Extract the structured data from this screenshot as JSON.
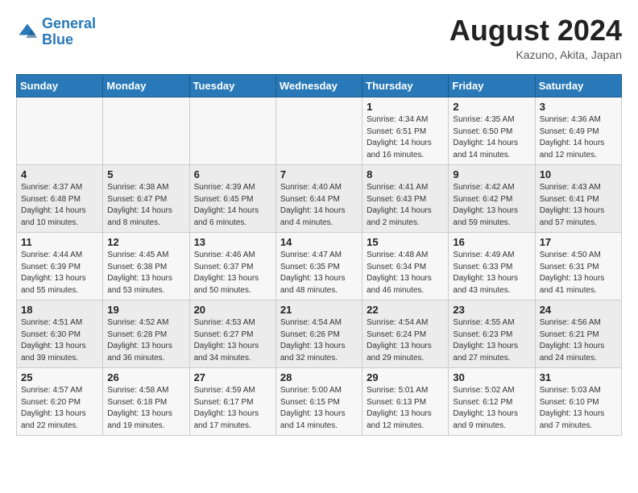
{
  "header": {
    "logo_line1": "General",
    "logo_line2": "Blue",
    "month_year": "August 2024",
    "location": "Kazuno, Akita, Japan"
  },
  "weekdays": [
    "Sunday",
    "Monday",
    "Tuesday",
    "Wednesday",
    "Thursday",
    "Friday",
    "Saturday"
  ],
  "weeks": [
    [
      {
        "day": "",
        "info": ""
      },
      {
        "day": "",
        "info": ""
      },
      {
        "day": "",
        "info": ""
      },
      {
        "day": "",
        "info": ""
      },
      {
        "day": "1",
        "info": "Sunrise: 4:34 AM\nSunset: 6:51 PM\nDaylight: 14 hours and 16 minutes."
      },
      {
        "day": "2",
        "info": "Sunrise: 4:35 AM\nSunset: 6:50 PM\nDaylight: 14 hours and 14 minutes."
      },
      {
        "day": "3",
        "info": "Sunrise: 4:36 AM\nSunset: 6:49 PM\nDaylight: 14 hours and 12 minutes."
      }
    ],
    [
      {
        "day": "4",
        "info": "Sunrise: 4:37 AM\nSunset: 6:48 PM\nDaylight: 14 hours and 10 minutes."
      },
      {
        "day": "5",
        "info": "Sunrise: 4:38 AM\nSunset: 6:47 PM\nDaylight: 14 hours and 8 minutes."
      },
      {
        "day": "6",
        "info": "Sunrise: 4:39 AM\nSunset: 6:45 PM\nDaylight: 14 hours and 6 minutes."
      },
      {
        "day": "7",
        "info": "Sunrise: 4:40 AM\nSunset: 6:44 PM\nDaylight: 14 hours and 4 minutes."
      },
      {
        "day": "8",
        "info": "Sunrise: 4:41 AM\nSunset: 6:43 PM\nDaylight: 14 hours and 2 minutes."
      },
      {
        "day": "9",
        "info": "Sunrise: 4:42 AM\nSunset: 6:42 PM\nDaylight: 13 hours and 59 minutes."
      },
      {
        "day": "10",
        "info": "Sunrise: 4:43 AM\nSunset: 6:41 PM\nDaylight: 13 hours and 57 minutes."
      }
    ],
    [
      {
        "day": "11",
        "info": "Sunrise: 4:44 AM\nSunset: 6:39 PM\nDaylight: 13 hours and 55 minutes."
      },
      {
        "day": "12",
        "info": "Sunrise: 4:45 AM\nSunset: 6:38 PM\nDaylight: 13 hours and 53 minutes."
      },
      {
        "day": "13",
        "info": "Sunrise: 4:46 AM\nSunset: 6:37 PM\nDaylight: 13 hours and 50 minutes."
      },
      {
        "day": "14",
        "info": "Sunrise: 4:47 AM\nSunset: 6:35 PM\nDaylight: 13 hours and 48 minutes."
      },
      {
        "day": "15",
        "info": "Sunrise: 4:48 AM\nSunset: 6:34 PM\nDaylight: 13 hours and 46 minutes."
      },
      {
        "day": "16",
        "info": "Sunrise: 4:49 AM\nSunset: 6:33 PM\nDaylight: 13 hours and 43 minutes."
      },
      {
        "day": "17",
        "info": "Sunrise: 4:50 AM\nSunset: 6:31 PM\nDaylight: 13 hours and 41 minutes."
      }
    ],
    [
      {
        "day": "18",
        "info": "Sunrise: 4:51 AM\nSunset: 6:30 PM\nDaylight: 13 hours and 39 minutes."
      },
      {
        "day": "19",
        "info": "Sunrise: 4:52 AM\nSunset: 6:28 PM\nDaylight: 13 hours and 36 minutes."
      },
      {
        "day": "20",
        "info": "Sunrise: 4:53 AM\nSunset: 6:27 PM\nDaylight: 13 hours and 34 minutes."
      },
      {
        "day": "21",
        "info": "Sunrise: 4:54 AM\nSunset: 6:26 PM\nDaylight: 13 hours and 32 minutes."
      },
      {
        "day": "22",
        "info": "Sunrise: 4:54 AM\nSunset: 6:24 PM\nDaylight: 13 hours and 29 minutes."
      },
      {
        "day": "23",
        "info": "Sunrise: 4:55 AM\nSunset: 6:23 PM\nDaylight: 13 hours and 27 minutes."
      },
      {
        "day": "24",
        "info": "Sunrise: 4:56 AM\nSunset: 6:21 PM\nDaylight: 13 hours and 24 minutes."
      }
    ],
    [
      {
        "day": "25",
        "info": "Sunrise: 4:57 AM\nSunset: 6:20 PM\nDaylight: 13 hours and 22 minutes."
      },
      {
        "day": "26",
        "info": "Sunrise: 4:58 AM\nSunset: 6:18 PM\nDaylight: 13 hours and 19 minutes."
      },
      {
        "day": "27",
        "info": "Sunrise: 4:59 AM\nSunset: 6:17 PM\nDaylight: 13 hours and 17 minutes."
      },
      {
        "day": "28",
        "info": "Sunrise: 5:00 AM\nSunset: 6:15 PM\nDaylight: 13 hours and 14 minutes."
      },
      {
        "day": "29",
        "info": "Sunrise: 5:01 AM\nSunset: 6:13 PM\nDaylight: 13 hours and 12 minutes."
      },
      {
        "day": "30",
        "info": "Sunrise: 5:02 AM\nSunset: 6:12 PM\nDaylight: 13 hours and 9 minutes."
      },
      {
        "day": "31",
        "info": "Sunrise: 5:03 AM\nSunset: 6:10 PM\nDaylight: 13 hours and 7 minutes."
      }
    ]
  ]
}
